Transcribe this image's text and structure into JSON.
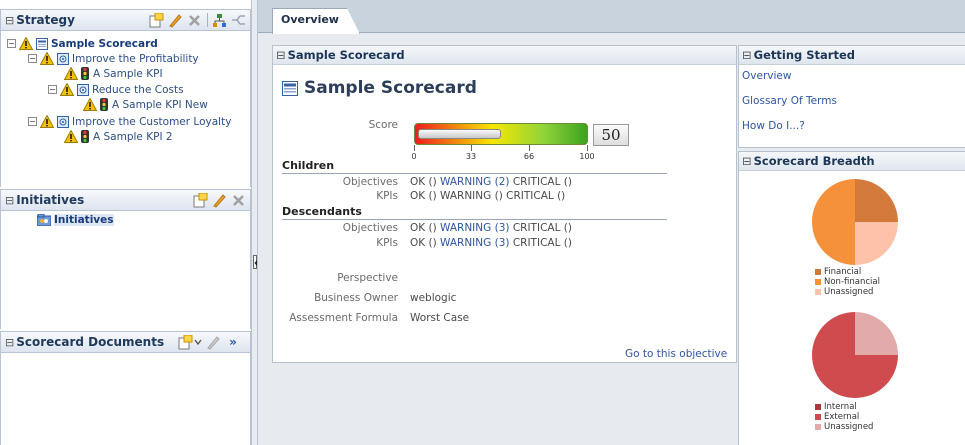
{
  "strategy": {
    "title": "Strategy",
    "toggle": "⊟",
    "tree": [
      {
        "label": "Sample Scorecard",
        "status_color": "#f2c200",
        "light": "none"
      },
      {
        "label": "Improve the Profitability"
      },
      {
        "label": "A Sample KPI"
      },
      {
        "label": "Reduce the Costs"
      },
      {
        "label": "A Sample KPI New"
      },
      {
        "label": "Improve the Customer Loyalty"
      },
      {
        "label": "A Sample KPI 2"
      }
    ]
  },
  "initiatives": {
    "title": "Initiatives",
    "toggle": "⊟",
    "items": [
      {
        "label": "Initiatives"
      }
    ]
  },
  "scorecard_documents": {
    "title": "Scorecard Documents",
    "toggle": "⊟",
    "more": "»"
  },
  "tabs": [
    {
      "label": "Overview"
    }
  ],
  "sample_card": {
    "header": "Sample Scorecard",
    "toggle": "⊟",
    "title": "Sample Scorecard",
    "score_label": "Score",
    "score_value": "50",
    "gauge_fill_percent": 50,
    "gauge_ticks": [
      "0",
      "33",
      "66",
      "100"
    ],
    "children": {
      "heading": "Children",
      "rows": [
        {
          "label": "Objectives",
          "ok": "OK ()",
          "warning": "WARNING (2)",
          "critical": "CRITICAL ()"
        },
        {
          "label": "KPIs",
          "ok": "OK ()",
          "warning": "WARNING ()",
          "critical": "CRITICAL ()"
        }
      ]
    },
    "descendants": {
      "heading": "Descendants",
      "rows": [
        {
          "label": "Objectives",
          "ok": "OK ()",
          "warning": "WARNING (3)",
          "critical": "CRITICAL ()"
        },
        {
          "label": "KPIs",
          "ok": "OK ()",
          "warning": "WARNING (3)",
          "critical": "CRITICAL ()"
        }
      ]
    },
    "perspective_label": "Perspective",
    "perspective_value": "",
    "owner_label": "Business Owner",
    "owner_value": "weblogic",
    "formula_label": "Assessment Formula",
    "formula_value": "Worst Case",
    "goto_link": "Go to this objective"
  },
  "getting_started": {
    "header": "Getting Started",
    "toggle": "⊟",
    "links": [
      "Overview",
      "Glossary Of Terms",
      "How Do I...?"
    ]
  },
  "scorecard_breadth": {
    "header": "Scorecard Breadth",
    "toggle": "⊟",
    "pie1": {
      "legend": [
        {
          "label": "Financial",
          "color": "#d27a3c"
        },
        {
          "label": "Non-financial",
          "color": "#f5913b"
        },
        {
          "label": "Unassigned",
          "color": "#fdc3a8"
        }
      ]
    },
    "pie2": {
      "legend": [
        {
          "label": "Internal",
          "color": "#a8383c"
        },
        {
          "label": "External",
          "color": "#cf4b4d"
        },
        {
          "label": "Unassigned",
          "color": "#e3aaab"
        }
      ]
    }
  },
  "colors": {
    "warning_yellow": "#f2c200",
    "link_blue": "#2e55a0",
    "panel_border": "#b8c4d6"
  }
}
